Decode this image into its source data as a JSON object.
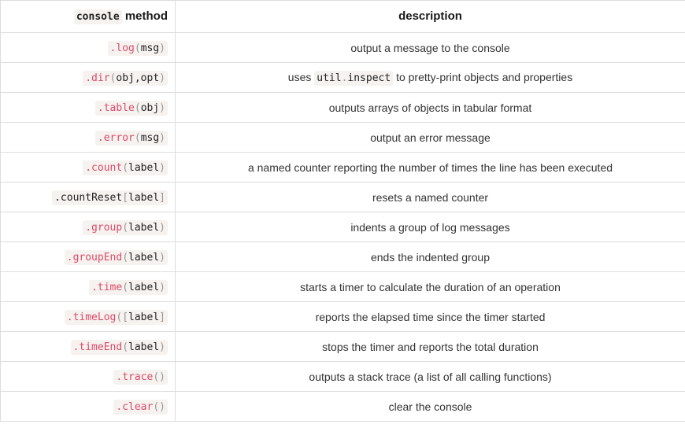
{
  "header": {
    "col1_code": "console",
    "col1_text": " method",
    "col2": "description"
  },
  "rows": [
    {
      "name": ".log",
      "open": "(",
      "args": "msg",
      "close": ")",
      "desc": "output a message to the console"
    },
    {
      "name": ".dir",
      "open": "(",
      "args": "obj,opt",
      "close": ")",
      "desc_before": "uses ",
      "desc_code_a": "util",
      "desc_code_dot": ".",
      "desc_code_b": "inspect",
      "desc_after": " to pretty-print objects and properties"
    },
    {
      "name": ".table",
      "open": "(",
      "args": "obj",
      "close": ")",
      "desc": "outputs arrays of objects in tabular format"
    },
    {
      "name": ".error",
      "open": "(",
      "args": "msg",
      "close": ")",
      "desc": "output an error message"
    },
    {
      "name": ".count",
      "open": "(",
      "args": "label",
      "close": ")",
      "desc": "a named counter reporting the number of times the line has been executed"
    },
    {
      "name": ".countReset",
      "open": "[",
      "args": "label",
      "close": "]",
      "desc": "resets a named counter"
    },
    {
      "name": ".group",
      "open": "(",
      "args": "label",
      "close": ")",
      "desc": "indents a group of log messages"
    },
    {
      "name": ".groupEnd",
      "open": "(",
      "args": "label",
      "close": ")",
      "desc": "ends the indented group"
    },
    {
      "name": ".time",
      "open": "(",
      "args": "label",
      "close": ")",
      "desc": "starts a timer to calculate the duration of an operation"
    },
    {
      "name": ".timeLog",
      "open": "([",
      "args": "label",
      "close": "]",
      "desc": "reports the elapsed time since the timer started"
    },
    {
      "name": ".timeEnd",
      "open": "(",
      "args": "label",
      "close": ")",
      "desc": "stops the timer and reports the total duration"
    },
    {
      "name": ".trace",
      "open": "()",
      "args": "",
      "close": "",
      "desc": "outputs a stack trace (a list of all calling functions)"
    },
    {
      "name": ".clear",
      "open": "()",
      "args": "",
      "close": "",
      "desc": "clear the console"
    }
  ]
}
